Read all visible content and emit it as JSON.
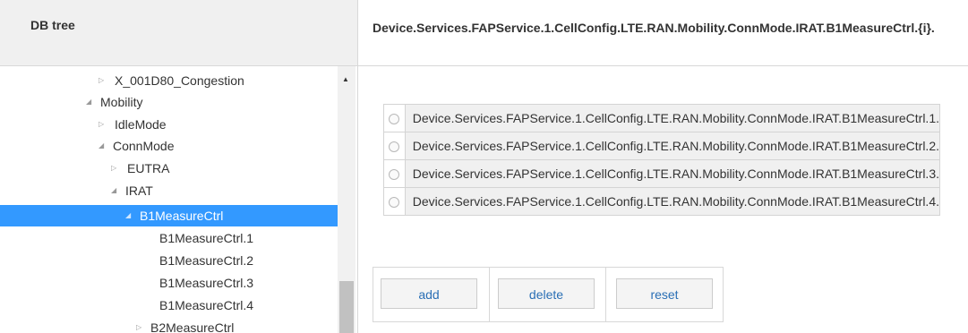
{
  "left_panel": {
    "title": "DB tree"
  },
  "right_panel": {
    "title": "Device.Services.FAPService.1.CellConfig.LTE.RAN.Mobility.ConnMode.IRAT.B1MeasureCtrl.{i}."
  },
  "tree": {
    "items": [
      {
        "label": "X_001D80_Congestion",
        "state": "collapsed",
        "selected": false
      },
      {
        "label": "Mobility",
        "state": "expanded",
        "selected": false
      },
      {
        "label": "IdleMode",
        "state": "collapsed",
        "selected": false
      },
      {
        "label": "ConnMode",
        "state": "expanded",
        "selected": false
      },
      {
        "label": "EUTRA",
        "state": "collapsed",
        "selected": false
      },
      {
        "label": "IRAT",
        "state": "expanded",
        "selected": false
      },
      {
        "label": "B1MeasureCtrl",
        "state": "expanded",
        "selected": true
      },
      {
        "label": "B1MeasureCtrl.1",
        "state": "leaf",
        "selected": false
      },
      {
        "label": "B1MeasureCtrl.2",
        "state": "leaf",
        "selected": false
      },
      {
        "label": "B1MeasureCtrl.3",
        "state": "leaf",
        "selected": false
      },
      {
        "label": "B1MeasureCtrl.4",
        "state": "leaf",
        "selected": false
      },
      {
        "label": "B2MeasureCtrl",
        "state": "collapsed",
        "selected": false
      }
    ]
  },
  "instances": [
    {
      "label": "Device.Services.FAPService.1.CellConfig.LTE.RAN.Mobility.ConnMode.IRAT.B1MeasureCtrl.1.",
      "checked": false
    },
    {
      "label": "Device.Services.FAPService.1.CellConfig.LTE.RAN.Mobility.ConnMode.IRAT.B1MeasureCtrl.2.",
      "checked": false
    },
    {
      "label": "Device.Services.FAPService.1.CellConfig.LTE.RAN.Mobility.ConnMode.IRAT.B1MeasureCtrl.3.",
      "checked": false
    },
    {
      "label": "Device.Services.FAPService.1.CellConfig.LTE.RAN.Mobility.ConnMode.IRAT.B1MeasureCtrl.4.",
      "checked": false
    }
  ],
  "actions": {
    "add_label": "add",
    "delete_label": "delete",
    "reset_label": "reset"
  },
  "colors": {
    "selection": "#3399ff",
    "button_text": "#2a6fb5",
    "header_bg": "#f0f0f0"
  },
  "icons": {
    "expanded": "triangle-down-icon",
    "collapsed": "triangle-right-icon"
  }
}
